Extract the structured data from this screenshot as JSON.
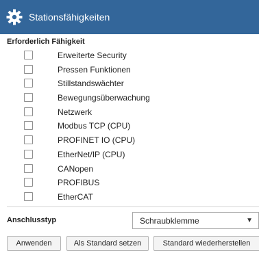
{
  "header": {
    "title": "Stationsfähigkeiten",
    "icon": "gear-icon",
    "background_color": "#33669a"
  },
  "capabilities": {
    "heading": "Erforderlich Fähigkeit",
    "items": [
      {
        "label": "Erweiterte Security",
        "checked": false
      },
      {
        "label": "Pressen Funktionen",
        "checked": false
      },
      {
        "label": "Stillstandswächter",
        "checked": false
      },
      {
        "label": "Bewegungsüberwachung",
        "checked": false
      },
      {
        "label": "Netzwerk",
        "checked": false
      },
      {
        "label": "Modbus TCP (CPU)",
        "checked": false
      },
      {
        "label": "PROFINET IO (CPU)",
        "checked": false
      },
      {
        "label": "EtherNet/IP (CPU)",
        "checked": false
      },
      {
        "label": "CANopen",
        "checked": false
      },
      {
        "label": "PROFIBUS",
        "checked": false
      },
      {
        "label": "EtherCAT",
        "checked": false
      }
    ]
  },
  "terminal": {
    "label": "Anschlusstyp",
    "selected": "Schraubklemme",
    "arrow_icon": "triangle-down-icon"
  },
  "actions": {
    "apply": "Anwenden",
    "set_default": "Als Standard setzen",
    "restore_default": "Standard wiederherstellen"
  }
}
